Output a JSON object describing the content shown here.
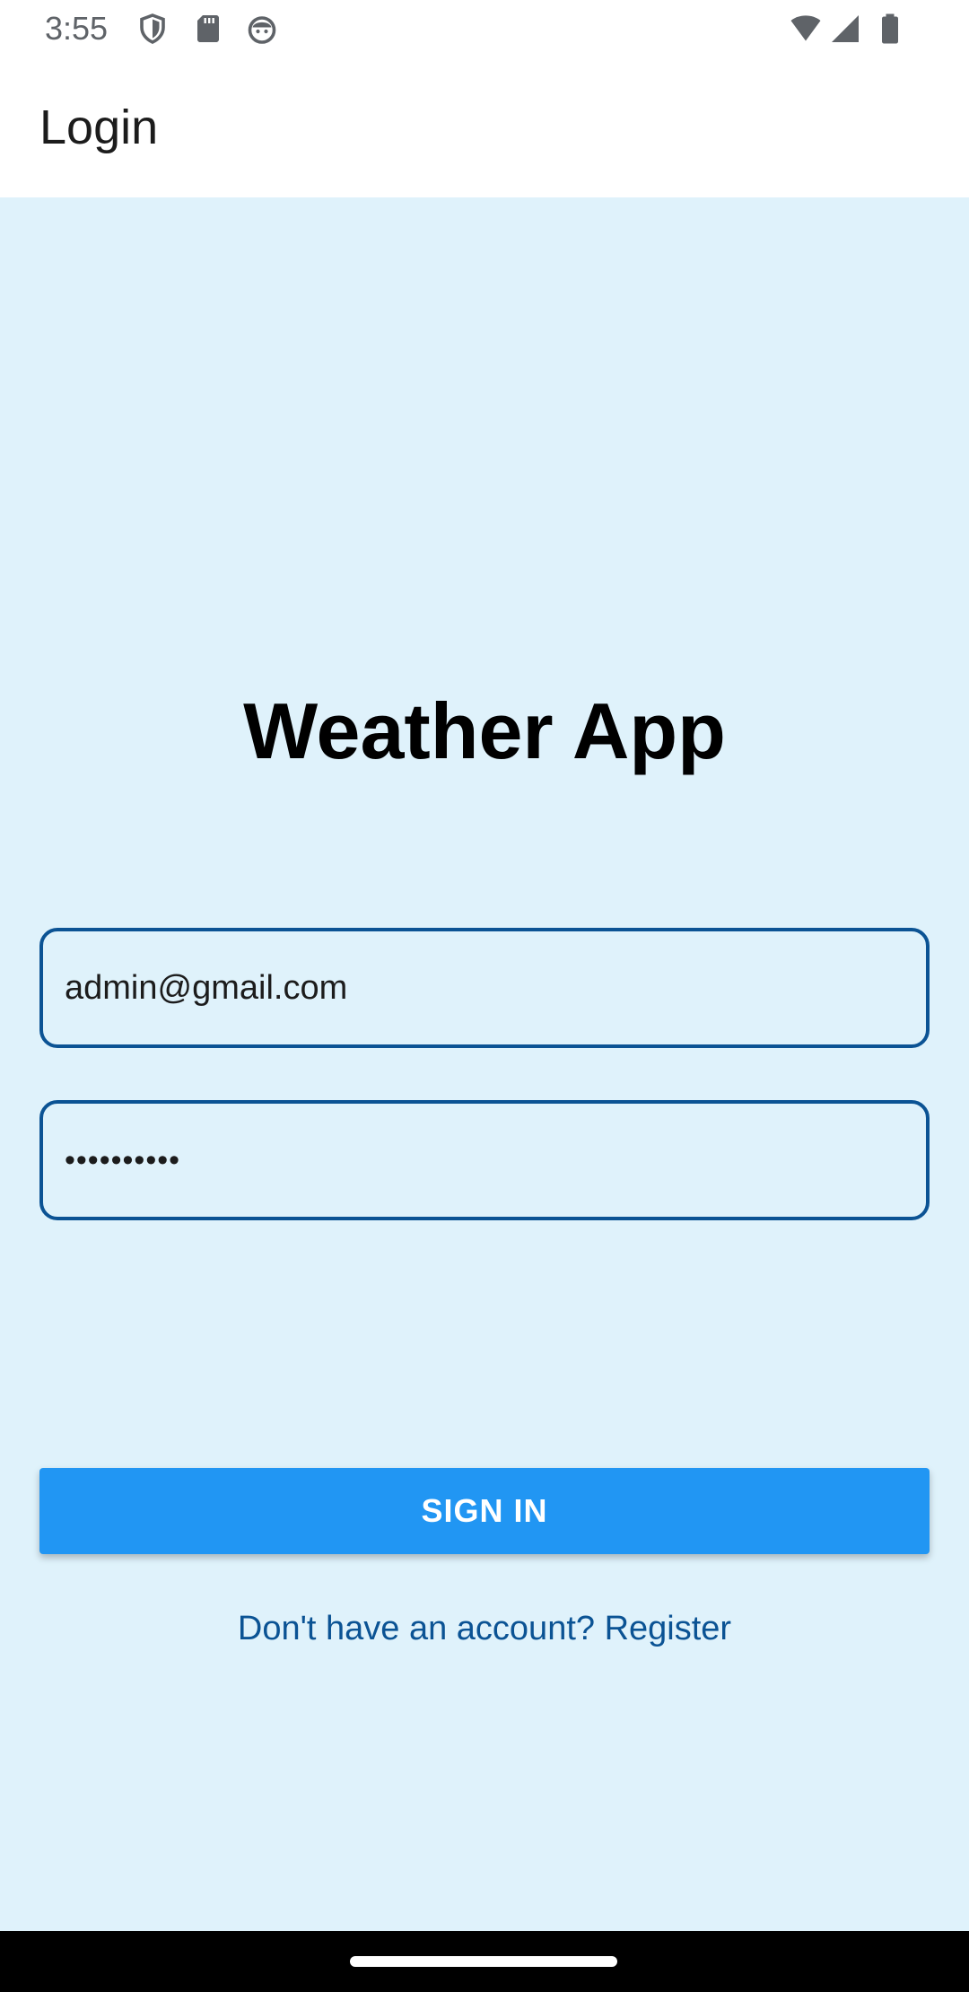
{
  "status_bar": {
    "time": "3:55",
    "left_icons": [
      "shield-icon",
      "sd-card-icon",
      "android-face-icon"
    ],
    "right_icons": [
      "wifi-icon",
      "signal-icon",
      "battery-icon"
    ]
  },
  "app_bar": {
    "title": "Login"
  },
  "main": {
    "heading": "Weather App",
    "email_field": {
      "value": "admin@gmail.com"
    },
    "password_field": {
      "value": "••••••••••"
    },
    "signin_label": "SIGN IN",
    "register_link": "Don't have an account? Register"
  },
  "colors": {
    "background": "#dff2fb",
    "accent": "#2196f3",
    "field_border": "#0b5394",
    "link": "#0b5394"
  }
}
